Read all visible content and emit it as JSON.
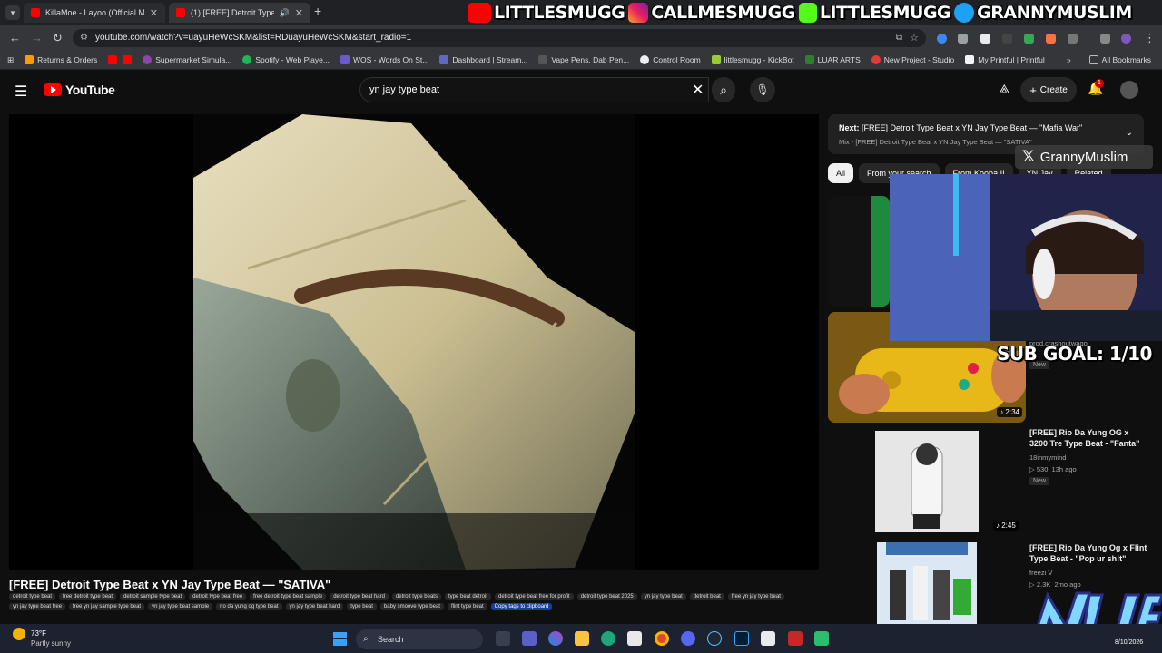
{
  "browser": {
    "tabs": [
      {
        "title": "KillaMoe - Layoo (Official Music"
      },
      {
        "title": "(1) [FREE] Detroit Type Beat"
      }
    ],
    "url": "youtube.com/watch?v=uayuHeWcSKM&list=RDuayuHeWcSKM&start_radio=1",
    "bookmarks": [
      "Returns & Orders",
      "Supermarket Simula...",
      "Spotify - Web Playe...",
      "WOS - Words On St...",
      "Dashboard | Stream...",
      "Vape Pens, Dab Pen...",
      "Control Room",
      "littlesmugg - KickBot",
      "LUAR ARTS",
      "New Project - Studio",
      "My Printful | Printful"
    ],
    "all_bookmarks": "All Bookmarks"
  },
  "stream_banner": {
    "youtube": "LITTLESMUGG",
    "instagram": "CALLMESMUGG",
    "kick": "LITTLESMUGG",
    "twitter": "GRANNYMUSLIM"
  },
  "youtube": {
    "logo": "YouTube",
    "search_query": "yn jay type beat",
    "create_label": "Create",
    "notification_count": "1",
    "video": {
      "title": "[FREE] Detroit Type Beat x YN Jay Type Beat — \"SATIVA\"",
      "tags": [
        "detroit type beat",
        "free detroit type beat",
        "detroit sample type beat",
        "detroit type beat free",
        "free detroit type beat sample",
        "detroit type beat hard",
        "detroit type beats",
        "type beat detroit",
        "detroit type beat free for profit",
        "detroit type beat 2025",
        "yn jay type beat",
        "detroit beat",
        "free yn jay type beat",
        "yn jay type beat free",
        "free yn jay sample type beat",
        "yn jay type beat sample",
        "rio da yung og type beat",
        "yn jay type beat hard",
        "type beat",
        "baby smoove type beat",
        "flint type beat"
      ],
      "copy_tags": "Copy tags to clipboard"
    },
    "up_next": {
      "label": "Next:",
      "title": "[FREE] Detroit Type Beat x YN Jay Type Beat — \"Mafia War\"",
      "subtitle": "Mix - [FREE] Detroit Type Beat x YN Jay Type Beat — \"SATIVA\""
    },
    "chips": [
      "All",
      "From your search",
      "From Kooba II",
      "YN Jay",
      "Related"
    ],
    "recommendations": [
      {
        "title": "",
        "channel": "",
        "duration": "",
        "badge": ""
      },
      {
        "title": "",
        "channel": "prod.crashoutwago",
        "duration": "2:34",
        "badge": "New"
      },
      {
        "title": "[FREE] Rio Da Yung OG x 3200 Tre Type Beat - \"Fanta\"",
        "channel": "18inmymind",
        "views": "530",
        "age": "13h ago",
        "duration": "2:45",
        "badge": "New"
      },
      {
        "title": "[FREE] Rio Da Yung Og x Flint Type Beat - \"Pop ur sh!t\"",
        "channel": "freezi V",
        "views": "2.3K",
        "age": "2mo ago",
        "duration": "",
        "badge": ""
      }
    ]
  },
  "overlays": {
    "x_handle": "GrannyMuslim",
    "sub_goal": "SUB GOAL: 1/10"
  },
  "taskbar": {
    "temperature": "73°F",
    "weather": "Partly sunny",
    "search_label": "Search",
    "date": "8/10/2026"
  },
  "colors": {
    "yt_red": "#ff0000",
    "background": "#0f0f0f",
    "copy_tags_bg": "#1a3f9a"
  }
}
